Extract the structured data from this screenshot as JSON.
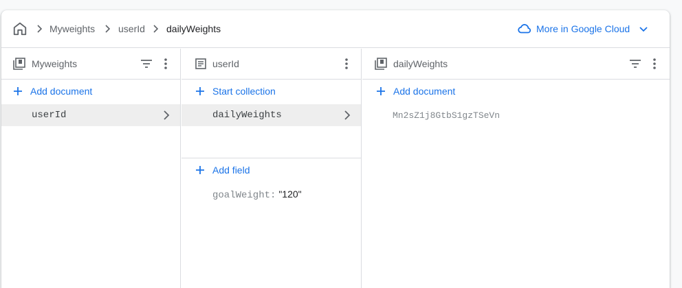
{
  "breadcrumb": {
    "home_icon": "home-icon",
    "items": [
      "Myweights",
      "userId",
      "dailyWeights"
    ]
  },
  "cloud_link": {
    "label": "More in Google Cloud",
    "icon": "cloud-icon"
  },
  "columns": [
    {
      "title": "Myweights",
      "icon": "collection-icon",
      "action": "Add document",
      "items": [
        {
          "label": "userId",
          "selected": true
        }
      ]
    },
    {
      "title": "userId",
      "icon": "document-icon",
      "action": "Start collection",
      "items": [
        {
          "label": "dailyWeights",
          "selected": true
        }
      ],
      "field_action": "Add field",
      "fields": [
        {
          "key": "goalWeight:",
          "value": "\"120\""
        }
      ]
    },
    {
      "title": "dailyWeights",
      "icon": "collection-icon",
      "action": "Add document",
      "items": [
        {
          "label": "Mn2sZ1j8GtbS1gzTSeVn",
          "selected": false
        }
      ]
    }
  ],
  "colors": {
    "accent": "#1a73e8",
    "selected_row": "#eeeeee",
    "border": "#dadce0"
  }
}
